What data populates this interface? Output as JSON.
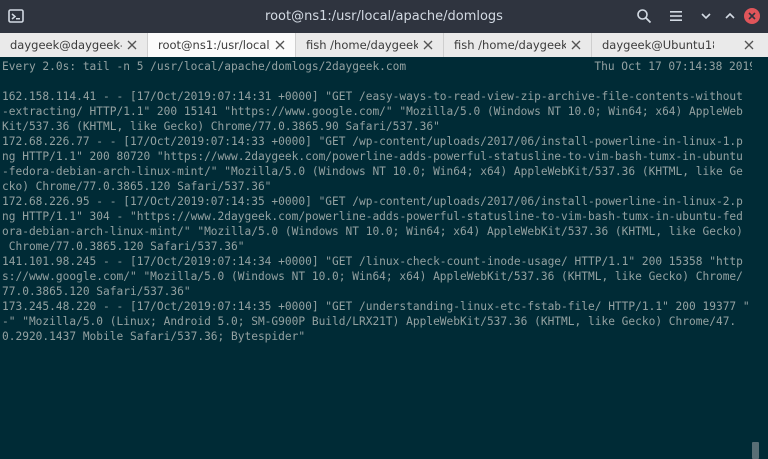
{
  "window": {
    "title": "root@ns1:/usr/local/apache/domlogs"
  },
  "tabs": [
    {
      "label": "daygeek@daygeek-..."
    },
    {
      "label": "root@ns1:/usr/local/..."
    },
    {
      "label": "fish /home/daygeek..."
    },
    {
      "label": "fish /home/daygeek..."
    },
    {
      "label": "daygeek@Ubuntu18..."
    }
  ],
  "terminal": {
    "watch_command": "Every 2.0s: tail -n 5 /usr/local/apache/domlogs/2daygeek.com",
    "timestamp": "Thu Oct 17 07:14:38 2019",
    "lines": [
      "162.158.114.41 - - [17/Oct/2019:07:14:31 +0000] \"GET /easy-ways-to-read-view-zip-archive-file-contents-without",
      "-extracting/ HTTP/1.1\" 200 15141 \"https://www.google.com/\" \"Mozilla/5.0 (Windows NT 10.0; Win64; x64) AppleWeb",
      "Kit/537.36 (KHTML, like Gecko) Chrome/77.0.3865.90 Safari/537.36\"",
      "172.68.226.77 - - [17/Oct/2019:07:14:33 +0000] \"GET /wp-content/uploads/2017/06/install-powerline-in-linux-1.p",
      "ng HTTP/1.1\" 200 80720 \"https://www.2daygeek.com/powerline-adds-powerful-statusline-to-vim-bash-tumx-in-ubuntu",
      "-fedora-debian-arch-linux-mint/\" \"Mozilla/5.0 (Windows NT 10.0; Win64; x64) AppleWebKit/537.36 (KHTML, like Ge",
      "cko) Chrome/77.0.3865.120 Safari/537.36\"",
      "172.68.226.95 - - [17/Oct/2019:07:14:35 +0000] \"GET /wp-content/uploads/2017/06/install-powerline-in-linux-2.p",
      "ng HTTP/1.1\" 304 - \"https://www.2daygeek.com/powerline-adds-powerful-statusline-to-vim-bash-tumx-in-ubuntu-fed",
      "ora-debian-arch-linux-mint/\" \"Mozilla/5.0 (Windows NT 10.0; Win64; x64) AppleWebKit/537.36 (KHTML, like Gecko)",
      " Chrome/77.0.3865.120 Safari/537.36\"",
      "141.101.98.245 - - [17/Oct/2019:07:14:34 +0000] \"GET /linux-check-count-inode-usage/ HTTP/1.1\" 200 15358 \"http",
      "s://www.google.com/\" \"Mozilla/5.0 (Windows NT 10.0; Win64; x64) AppleWebKit/537.36 (KHTML, like Gecko) Chrome/",
      "77.0.3865.120 Safari/537.36\"",
      "173.245.48.220 - - [17/Oct/2019:07:14:35 +0000] \"GET /understanding-linux-etc-fstab-file/ HTTP/1.1\" 200 19377 \"",
      "-\" \"Mozilla/5.0 (Linux; Android 5.0; SM-G900P Build/LRX21T) AppleWebKit/537.36 (KHTML, like Gecko) Chrome/47.",
      "0.2920.1437 Mobile Safari/537.36; Bytespider\""
    ]
  },
  "icons": {
    "app": "terminal-icon",
    "search": "search-icon",
    "menu": "hamburger-menu-icon",
    "minimize": "minimize-icon",
    "maximize": "maximize-icon",
    "close": "close-icon",
    "tab_close": "close-icon"
  },
  "colors": {
    "terminal_background": "#002b36",
    "terminal_text": "#93a1a1",
    "titlebar_background": "#2f343f",
    "close_button": "#e0555a"
  }
}
